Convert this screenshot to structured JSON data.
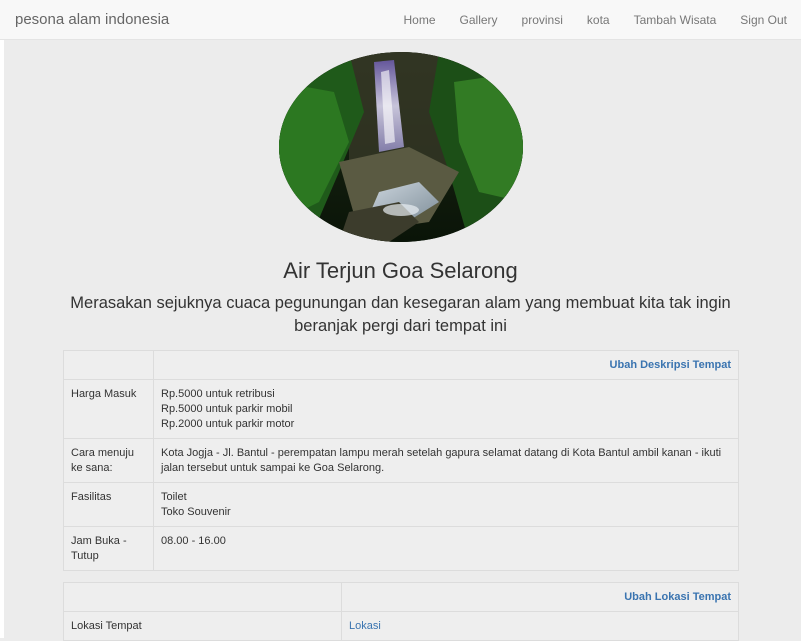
{
  "navbar": {
    "brand": "pesona alam indonesia",
    "items": [
      "Home",
      "Gallery",
      "provinsi",
      "kota",
      "Tambah Wisata",
      "Sign Out"
    ]
  },
  "place": {
    "title": "Air Terjun Goa Selarong",
    "tagline": "Merasakan sejuknya cuaca pegunungan dan kesegaran alam yang membuat kita tak ingin beranjak pergi dari tempat ini"
  },
  "description_table": {
    "action": "Ubah Deskripsi Tempat",
    "rows": [
      {
        "label": "Harga Masuk",
        "lines": [
          "Rp.5000 untuk retribusi",
          "Rp.5000 untuk parkir mobil",
          "Rp.2000 untuk parkir motor"
        ]
      },
      {
        "label": "Cara menuju ke sana:",
        "lines": [
          "Kota Jogja - Jl. Bantul - perempatan lampu merah setelah gapura selamat datang di Kota Bantul ambil kanan - ikuti jalan tersebut untuk sampai ke Goa Selarong."
        ]
      },
      {
        "label": "Fasilitas",
        "lines": [
          "Toilet",
          "Toko Souvenir"
        ]
      },
      {
        "label": "Jam Buka - Tutup",
        "lines": [
          "08.00 - 16.00"
        ]
      }
    ]
  },
  "location_table": {
    "action": "Ubah Lokasi Tempat",
    "label": "Lokasi Tempat",
    "link": "Lokasi"
  }
}
